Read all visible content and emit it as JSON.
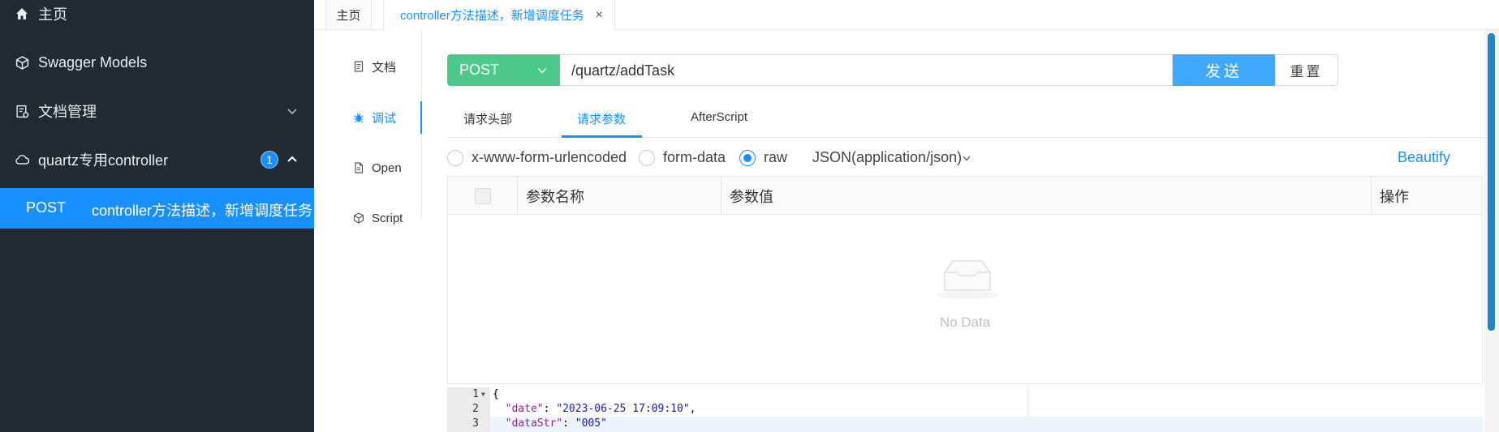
{
  "sidebar": {
    "items": [
      {
        "label": "主页",
        "icon": "home-icon"
      },
      {
        "label": "Swagger Models",
        "icon": "cube-icon"
      },
      {
        "label": "文档管理",
        "icon": "doc-settings-icon"
      },
      {
        "label": "quartz专用controller",
        "icon": "cloud-icon",
        "badge": "1"
      }
    ],
    "active_item": {
      "method": "POST",
      "title": "controller方法描述，新增调度任务"
    }
  },
  "tabs": [
    {
      "label": "主页"
    },
    {
      "label": "controller方法描述，新增调度任务",
      "close": "×"
    }
  ],
  "inner_nav": [
    {
      "label": "文档",
      "icon": "document-icon"
    },
    {
      "label": "调试",
      "icon": "bug-icon"
    },
    {
      "label": "Open",
      "icon": "file-icon"
    },
    {
      "label": "Script",
      "icon": "code-icon"
    }
  ],
  "request": {
    "method": "POST",
    "url": "/quartz/addTask",
    "send_label": "发送",
    "reset_label": "重置"
  },
  "subtabs": [
    "请求头部",
    "请求参数",
    "AfterScript"
  ],
  "body_types": {
    "options": [
      "x-www-form-urlencoded",
      "form-data",
      "raw"
    ],
    "selected": "raw",
    "content_type": "JSON(application/json)",
    "beautify_label": "Beautify"
  },
  "param_table": {
    "headers": [
      "参数名称",
      "参数值",
      "操作"
    ],
    "empty_text": "No Data"
  },
  "editor": {
    "line_numbers": [
      "1",
      "2",
      "3"
    ],
    "line1": "{",
    "line2_key": "\"date\"",
    "line2_val": "\"2023-06-25 17:09:10\"",
    "line3_key": "\"dataStr\"",
    "line3_val": "\"005\""
  },
  "colors": {
    "accent": "#1890ff",
    "method_post": "#4dca8b",
    "sidebar_bg": "#1f2a32"
  }
}
